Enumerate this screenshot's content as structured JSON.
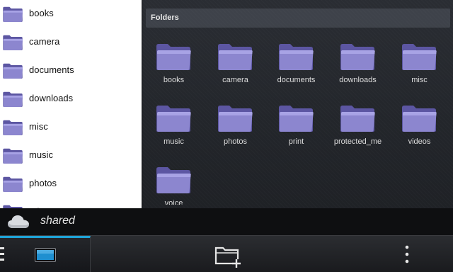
{
  "colors": {
    "accent": "#1fa4d8",
    "folder": "#8c86cf",
    "folder_dark": "#5c56a2"
  },
  "list_panel": {
    "items": [
      {
        "label": "books"
      },
      {
        "label": "camera"
      },
      {
        "label": "documents"
      },
      {
        "label": "downloads"
      },
      {
        "label": "misc"
      },
      {
        "label": "music"
      },
      {
        "label": "photos"
      },
      {
        "label": "print"
      }
    ]
  },
  "folders": {
    "header": "Folders",
    "items": [
      {
        "label": "books"
      },
      {
        "label": "camera"
      },
      {
        "label": "documents"
      },
      {
        "label": "downloads"
      },
      {
        "label": "misc"
      },
      {
        "label": "music"
      },
      {
        "label": "photos"
      },
      {
        "label": "print"
      },
      {
        "label": "protected_media"
      },
      {
        "label": "videos"
      },
      {
        "label": "voice"
      }
    ]
  },
  "shared_bar": {
    "label": "shared",
    "icon": "cloud-icon"
  },
  "action_bar": {
    "active_tab_icon": "tablet-icon",
    "new_folder_icon": "new-folder-icon",
    "overflow_icon": "overflow-menu-icon",
    "menu_icon": "menu-dots-icon"
  }
}
